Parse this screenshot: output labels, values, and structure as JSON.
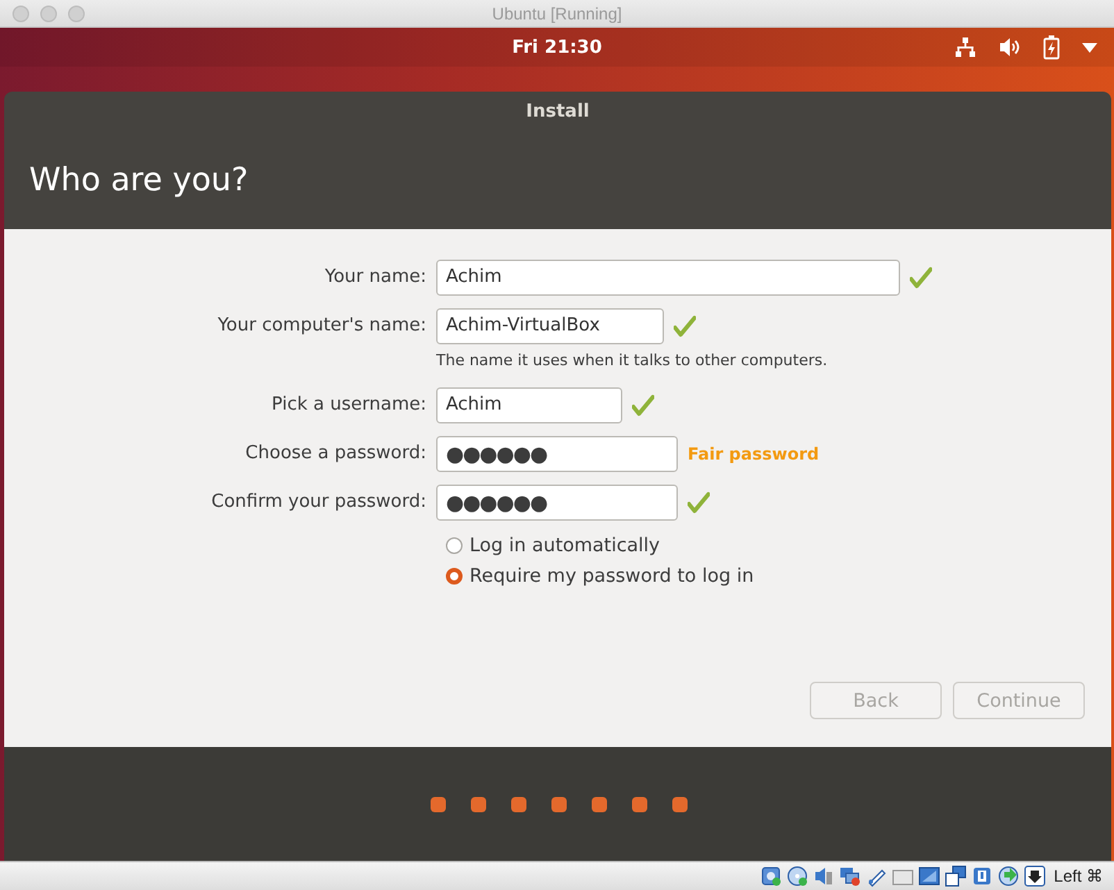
{
  "window": {
    "title": "Ubuntu [Running]"
  },
  "top_bar": {
    "clock": "Fri 21:30"
  },
  "installer": {
    "title": "Install",
    "heading": "Who are you?",
    "fields": [
      {
        "label": "Your name:",
        "value": "Achim",
        "kind": "text",
        "valid": true
      },
      {
        "label": "Your computer's name:",
        "value": "Achim-VirtualBox",
        "kind": "text",
        "valid": true,
        "hint": "The name it uses when it talks to other computers."
      },
      {
        "label": "Pick a username:",
        "value": "Achim",
        "kind": "text",
        "valid": true
      },
      {
        "label": "Choose a password:",
        "value": "●●●●●●",
        "kind": "password",
        "valid": false,
        "strength": "Fair password"
      },
      {
        "label": "Confirm your password:",
        "value": "●●●●●●",
        "kind": "password",
        "valid": true
      }
    ],
    "login_options": [
      {
        "label": "Log in automatically",
        "selected": false
      },
      {
        "label": "Require my password to log in",
        "selected": true
      }
    ],
    "buttons": [
      {
        "label": "Back",
        "disabled": true
      },
      {
        "label": "Continue",
        "disabled": true
      }
    ],
    "steps": [
      {
        "selected": false
      },
      {
        "selected": false
      },
      {
        "selected": false
      },
      {
        "selected": false
      },
      {
        "selected": false
      },
      {
        "selected": false
      },
      {
        "selected": false
      }
    ]
  },
  "status_bar": {
    "host_key": "Left ⌘"
  }
}
